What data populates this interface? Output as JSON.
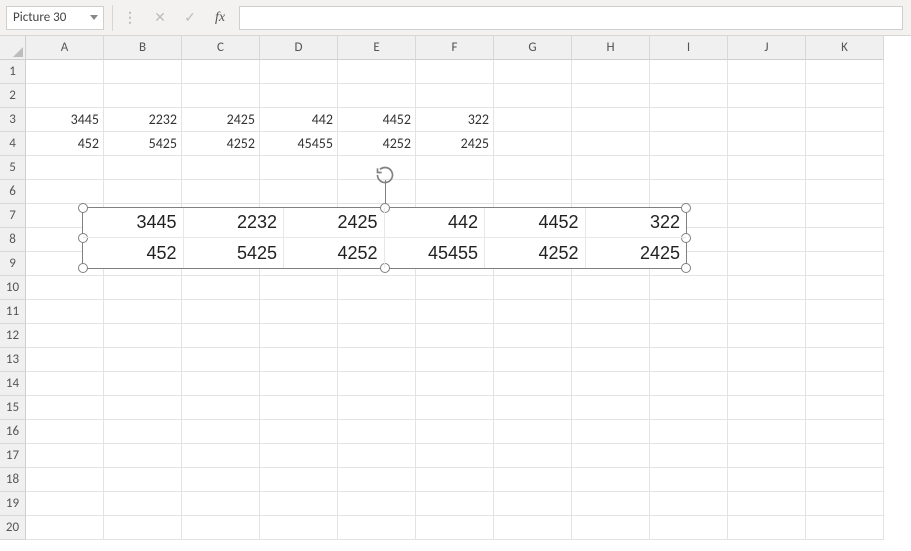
{
  "name_box": {
    "value": "Picture 30"
  },
  "formula_bar_buttons": {
    "dots": "⋮",
    "cancel": "✕",
    "enter": "✓",
    "fx": "fx"
  },
  "columns": [
    "A",
    "B",
    "C",
    "D",
    "E",
    "F",
    "G",
    "H",
    "I",
    "J",
    "K"
  ],
  "rows": [
    "1",
    "2",
    "3",
    "4",
    "5",
    "6",
    "7",
    "8",
    "9",
    "10",
    "11",
    "12",
    "13",
    "14",
    "15",
    "16",
    "17",
    "18",
    "19",
    "20"
  ],
  "grid_data": {
    "3": {
      "A": "3445",
      "B": "2232",
      "C": "2425",
      "D": "442",
      "E": "4452",
      "F": "322"
    },
    "4": {
      "A": "452",
      "B": "5425",
      "C": "4252",
      "D": "45455",
      "E": "4252",
      "F": "2425"
    }
  },
  "picture": {
    "rows": [
      [
        "3445",
        "2232",
        "2425",
        "442",
        "4452",
        "322"
      ],
      [
        "452",
        "5425",
        "4252",
        "45455",
        "4252",
        "2425"
      ]
    ]
  }
}
